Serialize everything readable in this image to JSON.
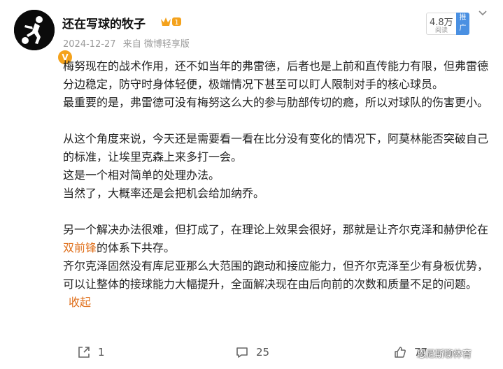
{
  "post": {
    "username": "还在写球的牧子",
    "crown_level": "1",
    "verified_badge": "V",
    "date": "2024-12-27",
    "source": "来自 微博轻享版",
    "views": "4.8万",
    "views_label": "阅读",
    "promote_label": "推广"
  },
  "content": {
    "p1": "梅努现在的战术作用，还不如当年的弗雷德，后者也是上前和直传能力有限，但弗雷德分边稳定，防守时身体轻便，极端情况下甚至可以盯人限制对手的核心球员。",
    "p2": "最重要的是，弗雷德可没有梅努这么大的参与肋部传切的瘾，所以对球队的伤害更小。",
    "p3": "从这个角度来说，今天还是需要看一看在比分没有变化的情况下，阿莫林能否突破自己的标准，让埃里克森上来多打一会。",
    "p4": "这是一个相对简单的处理办法。",
    "p5": "当然了，大概率还是会把机会给加纳乔。",
    "p6_a": "另一个解决办法很难，但打成了，在理论上效果会很好，那就是让齐尔克泽和赫伊伦在",
    "p6_link": "双前锋",
    "p6_b": "的体系下共存。",
    "p7": "齐尔克泽固然没有库尼亚那么大范围的跑动和接应能力，但齐尔克泽至少有身板优势，可以让整体的接球能力大幅提升，全面解决现在由后向前的次数和质量不足的问题。",
    "collapse_label": "收起"
  },
  "actions": {
    "share_count": "1",
    "comment_count": "25",
    "like_count": "77"
  },
  "watermark": "恩尼斯聊体育",
  "colors": {
    "link": "#e0701c",
    "verified": "#f4a21c",
    "promote": "#4a90e2"
  }
}
